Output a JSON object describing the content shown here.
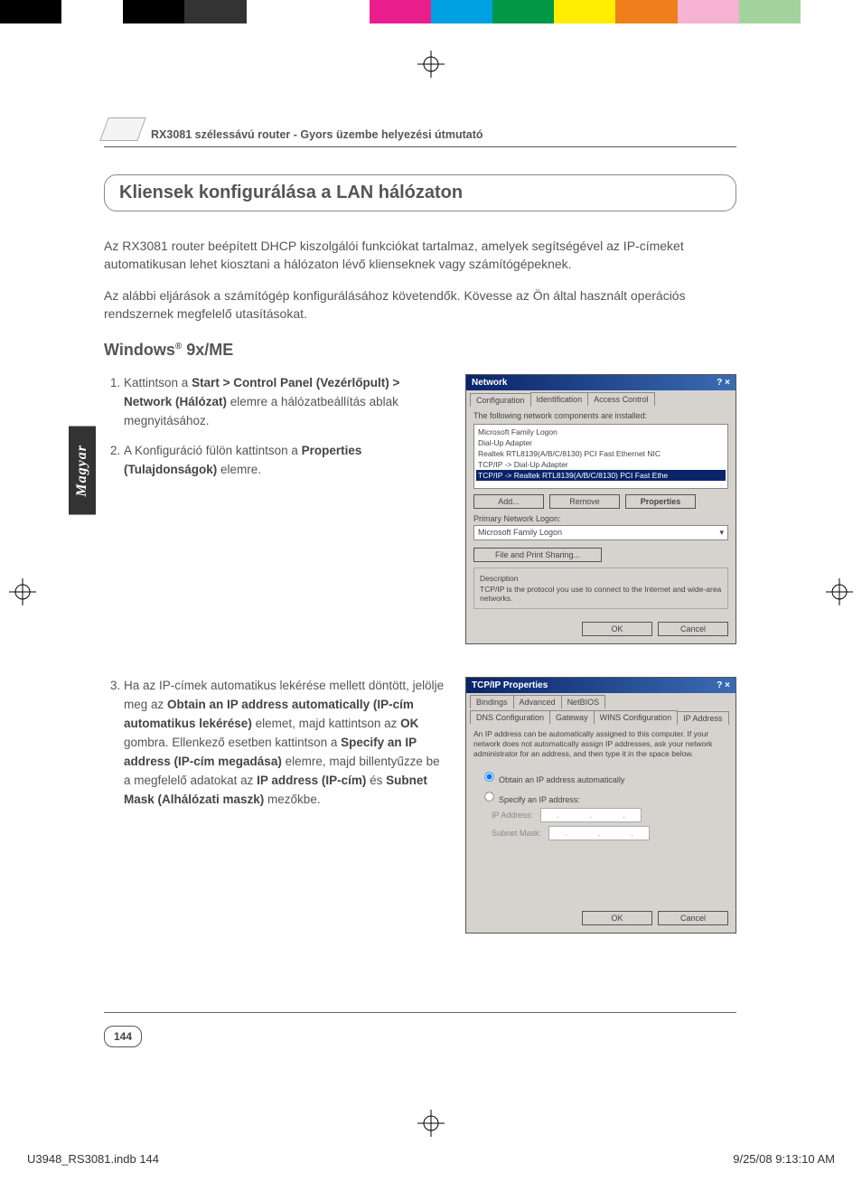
{
  "colorbar": [
    "#000",
    "#fff",
    "#000",
    "#333",
    "#fff",
    "#fff",
    "#e91e8c",
    "#00a0e3",
    "#009846",
    "#ffed00",
    "#ef7f1a",
    "#f6b2d2",
    "#a3d39c",
    "#fff"
  ],
  "header": {
    "title": "RX3081 szélessávú router - Gyors üzembe helyezési útmutató"
  },
  "section": {
    "title": "Kliensek konfigurálása a LAN hálózaton"
  },
  "intro": {
    "p1": "Az RX3081 router beépített DHCP kiszolgálói funkciókat tartalmaz, amelyek segítségével az IP-címeket automatikusan lehet kiosztani a hálózaton lévő klienseknek vagy számítógépeknek.",
    "p2": "Az alábbi eljárások a számítógép konfigurálásához követendők. Kövesse az Ön által használt operációs rendszernek megfelelő utasításokat."
  },
  "subheading": {
    "text": "Windows",
    "sup": "®",
    "suffix": " 9x/ME"
  },
  "step1": {
    "pre": "Kattintson a ",
    "b1": "Start > Control Panel (Vezérlőpult) > Network (Hálózat)",
    "post": " elemre a hálózatbeállítás ablak megnyitásához."
  },
  "step2": {
    "pre": "A Konfiguráció fülön kattintson a ",
    "b1": "Properties (Tulajdonságok)",
    "post": " elemre."
  },
  "step3": {
    "pre": "Ha az IP-címek automatikus lekérése mellett döntött, jelölje meg az ",
    "b1": "Obtain an IP address automatically (IP-cím automatikus lekérése)",
    "mid1": " elemet, majd kattintson az ",
    "b2": "OK",
    "mid2": " gombra. Ellenkező esetben kattintson a ",
    "b3": "Specify an IP address (IP-cím megadása)",
    "mid3": " elemre, majd billentyűzze be a megfelelő adatokat az ",
    "b4": "IP address (IP-cím)",
    "mid4": " és ",
    "b5": "Subnet Mask (Alhálózati maszk)",
    "post": " mezőkbe."
  },
  "dlg1": {
    "title": "Network",
    "tabs": [
      "Configuration",
      "Identification",
      "Access Control"
    ],
    "listLabel": "The following network components are installed:",
    "items": [
      "Microsoft Family Logon",
      "Dial-Up Adapter",
      "Realtek RTL8139(A/B/C/8130) PCI Fast Ethernet NIC",
      "TCP/IP -> Dial-Up Adapter",
      "TCP/IP -> Realtek RTL8139(A/B/C/8130) PCI Fast Ethe"
    ],
    "btns": [
      "Add...",
      "Remove",
      "Properties"
    ],
    "primaryLabel": "Primary Network Logon:",
    "primaryValue": "Microsoft Family Logon",
    "fileShare": "File and Print Sharing...",
    "descLabel": "Description",
    "descText": "TCP/IP is the protocol you use to connect to the Internet and wide-area networks.",
    "ok": "OK",
    "cancel": "Cancel"
  },
  "dlg2": {
    "title": "TCP/IP Properties",
    "tabsTop": [
      "Bindings",
      "Advanced",
      "NetBIOS"
    ],
    "tabsBottom": [
      "DNS Configuration",
      "Gateway",
      "WINS Configuration",
      "IP Address"
    ],
    "desc": "An IP address can be automatically assigned to this computer. If your network does not automatically assign IP addresses, ask your network administrator for an address, and then type it in the space below.",
    "opt1": "Obtain an IP address automatically",
    "opt2": "Specify an IP address:",
    "ipLabel": "IP Address:",
    "maskLabel": "Subnet Mask:",
    "ok": "OK",
    "cancel": "Cancel"
  },
  "sideTab": "Magyar",
  "pageNum": "144",
  "footer": {
    "left": "U3948_RS3081.indb   144",
    "right": "9/25/08   9:13:10 AM"
  }
}
